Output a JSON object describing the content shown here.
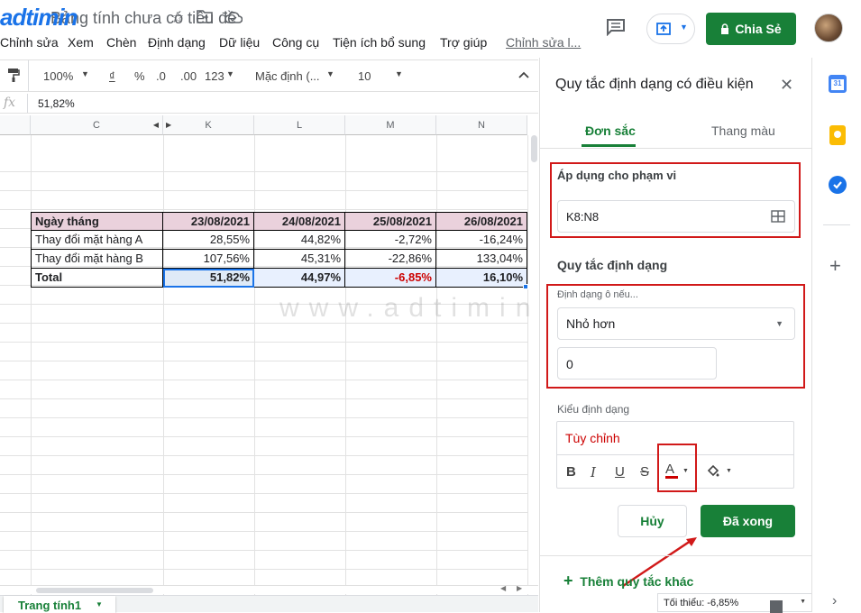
{
  "app": {
    "doc_title": "Bảng tính chưa có tiêu đề",
    "logo_text": "adtimin",
    "share_label": "Chia Sẻ",
    "menu": [
      "Chỉnh sửa",
      "Xem",
      "Chèn",
      "Định dạng",
      "Dữ liệu",
      "Công cụ",
      "Tiện ích bổ sung",
      "Trợ giúp"
    ],
    "last_edit": "Chỉnh sửa l..."
  },
  "toolbar": {
    "zoom": "100%",
    "currency": "₫",
    "percent": "%",
    "dec_less": ".0",
    "dec_more": ".00",
    "more_formats": "123",
    "font": "Mặc định (...",
    "font_size": "10"
  },
  "formula_bar": {
    "fx": "fx",
    "value": "51,82%"
  },
  "sheet": {
    "columns": [
      "C",
      "K",
      "L",
      "M",
      "N"
    ],
    "rows": [
      {
        "label": "Ngày tháng",
        "values": [
          "23/08/2021",
          "24/08/2021",
          "25/08/2021",
          "26/08/2021"
        ]
      },
      {
        "label": "Thay đổi mặt hàng A",
        "values": [
          "28,55%",
          "44,82%",
          "-2,72%",
          "-16,24%"
        ]
      },
      {
        "label": "Thay đổi mặt hàng B",
        "values": [
          "107,56%",
          "45,31%",
          "-22,86%",
          "133,04%"
        ]
      },
      {
        "label": "Total",
        "values": [
          "51,82%",
          "44,97%",
          "-6,85%",
          "16,10%"
        ]
      }
    ],
    "tab_name": "Trang tính1",
    "summary": "Tối thiểu: -6,85%"
  },
  "watermark": "www.adtimin.vn",
  "panel": {
    "title": "Quy tắc định dạng có điều kiện",
    "tab_single": "Đơn sắc",
    "tab_scale": "Thang màu",
    "range_label": "Áp dụng cho phạm vi",
    "range_value": "K8:N8",
    "rules_label": "Quy tắc định dạng",
    "condition_label": "Định dạng ô nếu...",
    "condition_value": "Nhỏ hơn",
    "condition_input": "0",
    "style_label": "Kiểu định dạng",
    "style_value": "Tùy chỉnh",
    "cancel": "Hủy",
    "done": "Đã xong",
    "add_rule": "Thêm quy tắc khác"
  },
  "colors": {
    "header_fill": "#ead1dc",
    "total_fill": "#dfeaf7",
    "negative": "#cc0000",
    "green": "#188038",
    "highlight_red": "#d11919"
  }
}
